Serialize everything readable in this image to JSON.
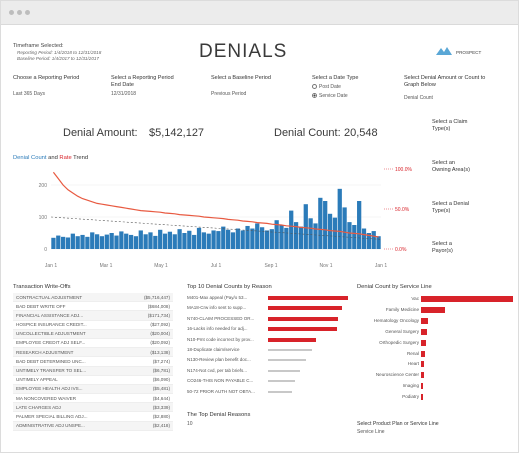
{
  "header": {
    "timeframe_title": "Timeframe Selected:",
    "timeframe_lines": [
      "Reporting Period: 1/4/2018 to 12/31/2018",
      "Baseline Period: 1/4/2017 to 12/31/2017"
    ],
    "page_title": "DENIALS",
    "logo_text": "PROSPECT"
  },
  "filters": [
    {
      "label": "Choose a Reporting Period",
      "value": "Last 365 Days"
    },
    {
      "label": "Select a Reporting Period End Date",
      "value": "12/31/2018"
    },
    {
      "label": "Select a Baseline Period",
      "value": "Previous Period"
    }
  ],
  "date_type": {
    "label": "Select a Date Type",
    "options": [
      "Post Date",
      "Service Date"
    ],
    "selected": "Service Date"
  },
  "graph_select": {
    "label": "Select Denial Amount or Count to Graph Below",
    "value": "Denial Count"
  },
  "metrics": {
    "amount_label": "Denial Amount:",
    "amount_value": "$5,142,127",
    "count_label": "Denial Count:",
    "count_value": "20,548"
  },
  "side_filters": [
    "Select a Claim Type(s)",
    "Select an Owning Area(s)",
    "Select a Denial Type(s)",
    "Select a Payor(s)"
  ],
  "trend": {
    "title_a": "Denial Count",
    "title_and": " and ",
    "title_b": "Rate",
    "title_c": " Trend"
  },
  "chart_data": {
    "type": "bar",
    "title": "Denial Count and Rate Trend",
    "x_ticks": [
      "Jan 1",
      "Mar 1",
      "May 1",
      "Jul 1",
      "Sep 1",
      "Nov 1",
      "Jan 1"
    ],
    "ylim": [
      0,
      250
    ],
    "y_ticks": [
      "200",
      "100",
      "0"
    ],
    "y2_ticks": [
      "100.0%",
      "50.0%",
      "0.0%"
    ],
    "series": [
      {
        "name": "Denial Count",
        "type": "bar",
        "color": "#2b7bb9",
        "values": [
          35,
          42,
          38,
          36,
          48,
          40,
          44,
          38,
          52,
          46,
          40,
          45,
          50,
          42,
          55,
          48,
          44,
          40,
          58,
          46,
          52,
          41,
          60,
          48,
          54,
          46,
          62,
          50,
          57,
          44,
          66,
          52,
          48,
          58,
          56,
          70,
          60,
          52,
          64,
          58,
          72,
          64,
          80,
          68,
          58,
          62,
          90,
          74,
          66,
          120,
          84,
          70,
          140,
          96,
          80,
          160,
          150,
          110,
          98,
          188,
          130,
          84,
          75,
          150,
          64,
          50,
          56,
          40
        ]
      },
      {
        "name": "Rate",
        "type": "line",
        "color": "#e85a41",
        "values": [
          96,
          88,
          80,
          74,
          70,
          66,
          63,
          61,
          59,
          57,
          56,
          55,
          54,
          53,
          52,
          51,
          50,
          49,
          48,
          47.5,
          47,
          46.5,
          46,
          45,
          44.5,
          44,
          43,
          42.5,
          42,
          41.5,
          41,
          40,
          39.5,
          39,
          38.5,
          38,
          37,
          36.5,
          36,
          35,
          34.5,
          34,
          33,
          32.5,
          32,
          31,
          30.5,
          30,
          29,
          28.5,
          28,
          27,
          26.5,
          26,
          25,
          24.5,
          24,
          23,
          22.5,
          22,
          21,
          20,
          19.5,
          19,
          18,
          17,
          16,
          15
        ]
      }
    ]
  },
  "write_offs": {
    "title": "Transaction Write-Offs",
    "rows": [
      {
        "name": "CONTRACTUAL ADJUSTMENT",
        "value": "($5,716,447)"
      },
      {
        "name": "BAD DEBT WRITE OFF",
        "value": "($684,008)"
      },
      {
        "name": "FINANCIAL ASSISTANCE ADJ...",
        "value": "($171,734)"
      },
      {
        "name": "HOSPICE INSURANCE CREDIT...",
        "value": "($27,092)"
      },
      {
        "name": "UNCOLLECTIBLE ADJUSTMENT",
        "value": "($20,004)"
      },
      {
        "name": "EMPLOYEE CREDIT ADJ SELF...",
        "value": "($20,092)"
      },
      {
        "name": "RESEARCH ADJUSTMENT",
        "value": "($13,138)"
      },
      {
        "name": "BAD DEBT DETERMINED UNC...",
        "value": "($7,274)"
      },
      {
        "name": "UNTIMELY TRANSFER TO SEL...",
        "value": "($6,781)"
      },
      {
        "name": "UNTIMELY APPEAL",
        "value": "($6,090)"
      },
      {
        "name": "EMPLOYEE HEALTH ADJ IVS...",
        "value": "($5,481)"
      },
      {
        "name": "MA NONCOVERED WAIVER",
        "value": "($4,644)"
      },
      {
        "name": "LATE CHARGES ADJ",
        "value": "($3,339)"
      },
      {
        "name": "PALMER SPECIAL BILLING ADJ...",
        "value": "($2,880)"
      },
      {
        "name": "ADMINISTRATIVE ADJ UNSPE...",
        "value": "($2,418)"
      }
    ]
  },
  "top_reasons": {
    "title": "Top 10 Denial Counts by Reason",
    "rows": [
      {
        "name": "M401-Max appeal (Pay/o 53...",
        "value": 100
      },
      {
        "name": "MA18-Crw info sent to supp...",
        "value": 92
      },
      {
        "name": "N740-CLAIM PROCESSED OR...",
        "value": 88
      },
      {
        "name": "16-Lacks info needed for adj...",
        "value": 86
      },
      {
        "name": "N10-Pmt code incorrect by prov...",
        "value": 60
      },
      {
        "name": "18-Duplicate claim/service",
        "value": 55
      },
      {
        "name": "N130-Review plan benefit doc...",
        "value": 48
      },
      {
        "name": "N174-Not cvd, per tab briefs...",
        "value": 40
      },
      {
        "name": "CO246-THIS NON PAYABLE C...",
        "value": 34
      },
      {
        "name": "50-72 PRIOR AUTH NOT OBTA...",
        "value": 30
      }
    ],
    "footer_label": "The Top Denial Reasons",
    "footer_value": "10"
  },
  "service_line": {
    "title": "Denial Count by Service Line",
    "rows": [
      {
        "name": "Vac",
        "value": 100
      },
      {
        "name": "Family Medicine",
        "value": 26
      },
      {
        "name": "Hematology Oncology",
        "value": 8
      },
      {
        "name": "General Surgery",
        "value": 6
      },
      {
        "name": "Orthopedic Surgery",
        "value": 5
      },
      {
        "name": "Renal",
        "value": 4
      },
      {
        "name": "Heart",
        "value": 3
      },
      {
        "name": "Neuroscience Center",
        "value": 3
      },
      {
        "name": "Imaging",
        "value": 2
      },
      {
        "name": "Podiatry",
        "value": 2
      }
    ],
    "footer_label": "Select Product Plan or Service Line",
    "footer_value": "Service Line"
  },
  "colors": {
    "accent_blue": "#2b7bb9",
    "accent_red": "#d8232a",
    "rate_line": "#e85a41"
  }
}
